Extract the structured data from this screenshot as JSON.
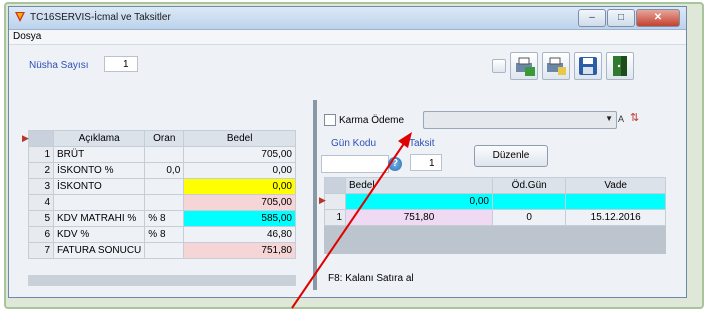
{
  "window": {
    "title": "TC16SERVIS-İcmal ve Taksitler"
  },
  "menu": {
    "items": [
      "Dosya"
    ]
  },
  "nusha": {
    "label": "Nüsha Sayısı",
    "value": "1"
  },
  "left_table": {
    "headers": [
      "Açıklama",
      "Oran",
      "Bedel"
    ],
    "rows": [
      {
        "no": "1",
        "aciklama": "BRÜT",
        "oran": "",
        "bedel": "705,00"
      },
      {
        "no": "2",
        "aciklama": "İSKONTO %",
        "oran": "0,0",
        "bedel": "0,00"
      },
      {
        "no": "3",
        "aciklama": "İSKONTO",
        "oran": "",
        "bedel": "0,00"
      },
      {
        "no": "4",
        "aciklama": "",
        "oran": "",
        "bedel": "705,00"
      },
      {
        "no": "5",
        "aciklama": "KDV MATRAHI %",
        "oran": "% 8",
        "bedel": "585,00"
      },
      {
        "no": "6",
        "aciklama": "KDV %",
        "oran": "% 8",
        "bedel": "46,80"
      },
      {
        "no": "7",
        "aciklama": "FATURA SONUCU",
        "oran": "",
        "bedel": "751,80"
      }
    ]
  },
  "karma": {
    "label": "Karma Ödeme",
    "combo_value": "",
    "a_label": "A"
  },
  "gun_kodu": {
    "label": "Gün Kodu",
    "value": ""
  },
  "taksit": {
    "label": "Taksit",
    "value": "1"
  },
  "duzenle_label": "Düzenle",
  "right_table": {
    "headers": [
      "Bedel",
      "Öd.Gün",
      "Vade"
    ],
    "rows": [
      {
        "no": "",
        "bedel": "0,00",
        "odgun": "",
        "vade": ""
      },
      {
        "no": "1",
        "bedel": "751,80",
        "odgun": "0",
        "vade": "15.12.2016"
      }
    ]
  },
  "footer_hint": "F8: Kalanı Satıra al",
  "colors": {
    "yellow": "#ffff00",
    "cyan": "#00ffff",
    "pink": "#f5d5d5",
    "lilac": "#efd9f3",
    "arrow": "#e00000"
  }
}
